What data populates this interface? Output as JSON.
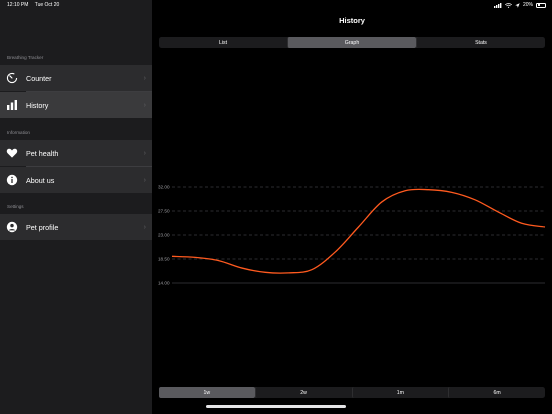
{
  "status": {
    "time": "12:10 PM",
    "date": "Tue Oct 20",
    "battery": "20%"
  },
  "sidebar": {
    "sections": [
      {
        "header": "Breathing Tracker",
        "items": [
          {
            "label": "Counter",
            "icon": "timer-icon",
            "selected": false
          },
          {
            "label": "History",
            "icon": "bar-chart-icon",
            "selected": true
          }
        ]
      },
      {
        "header": "Information",
        "items": [
          {
            "label": "Pet health",
            "icon": "heart-icon",
            "selected": false
          },
          {
            "label": "About us",
            "icon": "info-icon",
            "selected": false
          }
        ]
      },
      {
        "header": "Settings",
        "items": [
          {
            "label": "Pet profile",
            "icon": "person-circle-icon",
            "selected": false
          }
        ]
      }
    ]
  },
  "main": {
    "title": "History",
    "view_tabs": [
      "List",
      "Graph",
      "Stats"
    ],
    "active_view": "Graph",
    "range_tabs": [
      "1w",
      "2w",
      "1m",
      "6m"
    ],
    "active_range": "1w"
  },
  "chart_data": {
    "type": "line",
    "title": "",
    "xlabel": "",
    "ylabel": "",
    "y_ticks": [
      "32.00",
      "27.50",
      "23.00",
      "18.50",
      "14.00"
    ],
    "ylim": [
      14,
      32
    ],
    "grid": true,
    "line_color": "#ff5a1f",
    "x": [
      0,
      1,
      2,
      3,
      4,
      5,
      6,
      7,
      8,
      9,
      10,
      11,
      12,
      13,
      14,
      15,
      16
    ],
    "series": [
      {
        "values": [
          19.0,
          18.8,
          18.2,
          16.8,
          16.0,
          15.9,
          16.5,
          19.8,
          24.5,
          29.2,
          31.3,
          31.5,
          31.0,
          29.6,
          27.3,
          25.2,
          24.5
        ]
      }
    ]
  },
  "colors": {
    "sidebar_bg": "#1c1c1e",
    "row_bg": "#2c2c2e",
    "selected_bg": "#3a3a3c",
    "accent": "#ff5a1f"
  }
}
